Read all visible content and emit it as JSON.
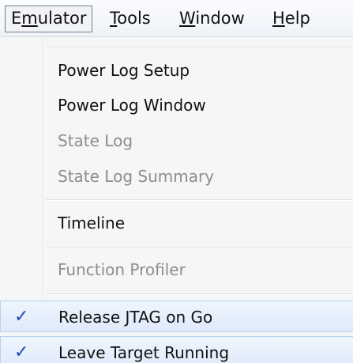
{
  "menubar": {
    "emulator": {
      "first": "E",
      "mnemonic": "m",
      "rest": "ulator"
    },
    "tools": {
      "mnemonic": "T",
      "rest": "ools"
    },
    "window": {
      "mnemonic": "W",
      "rest": "indow"
    },
    "help": {
      "mnemonic": "H",
      "rest": "elp"
    }
  },
  "menu": {
    "power_log_setup": "Power Log Setup",
    "power_log_window": "Power Log Window",
    "state_log": "State Log",
    "state_log_summary": "State Log Summary",
    "timeline": "Timeline",
    "function_profiler": "Function Profiler",
    "release_jtag_on_go": "Release JTAG on Go",
    "leave_target_running": "Leave Target Running",
    "check_mark": "✓"
  }
}
